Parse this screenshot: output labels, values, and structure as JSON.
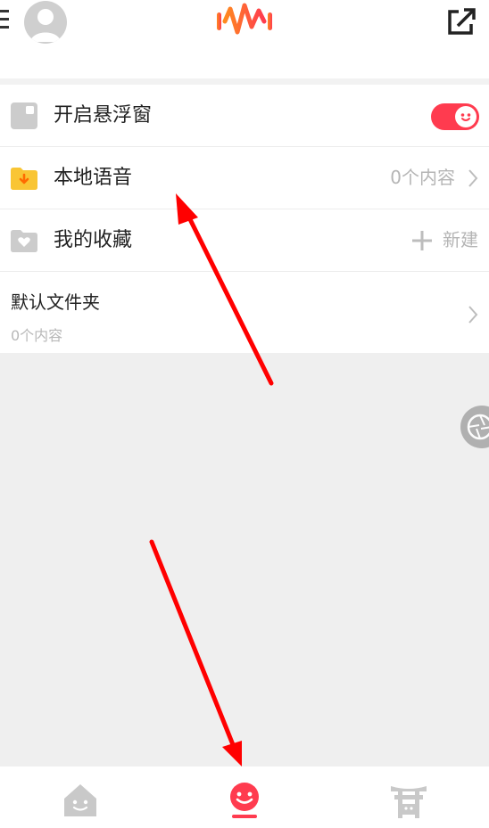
{
  "header": {
    "menu_icon": "menu-icon",
    "avatar_icon": "avatar-icon",
    "logo_icon": "soundwave-logo-icon",
    "share_icon": "share-icon"
  },
  "list": {
    "floating_window": {
      "label": "开启悬浮窗",
      "toggle_on": true
    },
    "local_voice": {
      "label": "本地语音",
      "count": "0个内容"
    },
    "favorites": {
      "label": "我的收藏",
      "action": "新建"
    },
    "default_folder": {
      "title": "默认文件夹",
      "count": "0个内容"
    }
  },
  "tabbar": {
    "tabs": [
      {
        "icon": "home-face-icon",
        "active": false
      },
      {
        "icon": "smile-face-icon",
        "active": true
      },
      {
        "icon": "shrine-gate-icon",
        "active": false
      }
    ]
  },
  "colors": {
    "accent": "#ff3b4f",
    "folder_yellow": "#f9c534",
    "annotation_red": "#ff0000"
  }
}
